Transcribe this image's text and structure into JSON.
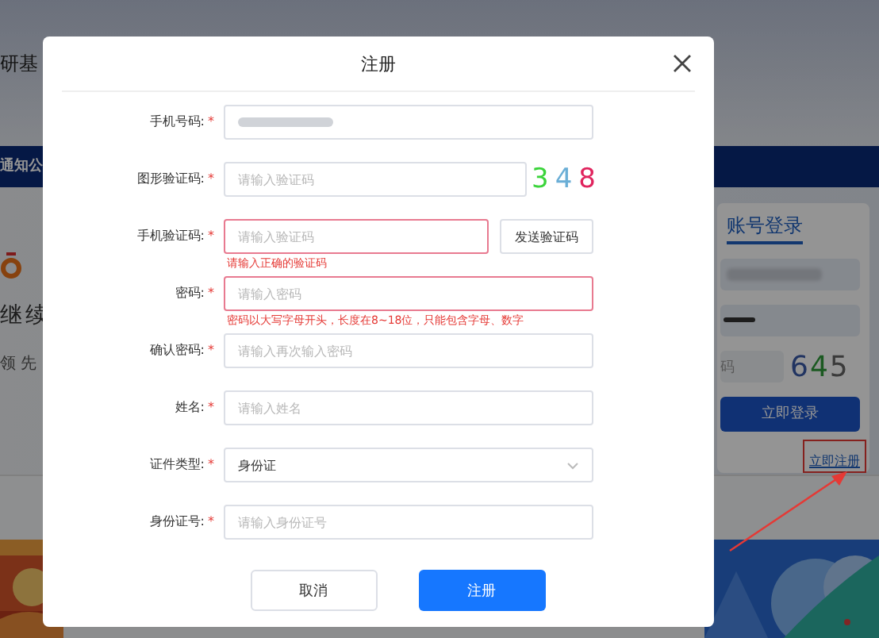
{
  "background": {
    "site_title": "研基",
    "notice_tab": "通知公",
    "hero_line_1": "继续",
    "hero_line_2": "领 先",
    "login": {
      "title": "账号登录",
      "captcha_placeholder": "码",
      "captcha": "645",
      "login_button": "立即登录",
      "register_link": "立即注册"
    }
  },
  "dialog": {
    "title": "注册",
    "fields": [
      {
        "kind": "masked",
        "label": "手机号码:",
        "required_mark": "*",
        "error": false
      },
      {
        "kind": "captcha",
        "label": "图形验证码:",
        "required_mark": "*",
        "error": false,
        "placeholder": "请输入验证码",
        "captcha": "348"
      },
      {
        "kind": "sms",
        "label": "手机验证码:",
        "required_mark": "*",
        "error": true,
        "placeholder": "请输入验证码",
        "button": "发送验证码",
        "message": "请输入正确的验证码"
      },
      {
        "kind": "text",
        "label": "密码:",
        "required_mark": "*",
        "error": true,
        "placeholder": "请输入密码",
        "message": "密码以大写字母开头，长度在8~18位，只能包含字母、数字"
      },
      {
        "kind": "text",
        "label": "确认密码:",
        "required_mark": "*",
        "error": false,
        "placeholder": "请输入再次输入密码"
      },
      {
        "kind": "text",
        "label": "姓名:",
        "required_mark": "*",
        "error": false,
        "placeholder": "请输入姓名"
      },
      {
        "kind": "select",
        "label": "证件类型:",
        "required_mark": "*",
        "error": false,
        "value": "身份证"
      },
      {
        "kind": "text",
        "label": "身份证号:",
        "required_mark": "*",
        "error": false,
        "placeholder": "请输入身份证号"
      }
    ],
    "buttons": [
      {
        "label": "取消",
        "kind": "secondary"
      },
      {
        "label": "注册",
        "kind": "primary"
      }
    ]
  }
}
